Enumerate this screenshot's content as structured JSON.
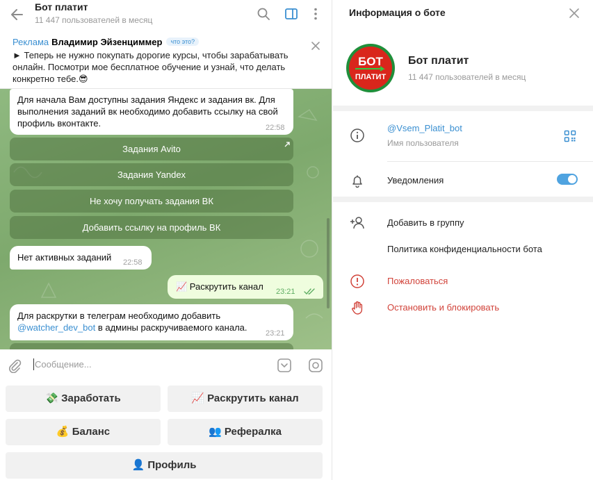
{
  "chat": {
    "title": "Бот платит",
    "subtitle": "11 447 пользователей в месяц"
  },
  "ad": {
    "label": "Реклама",
    "author": "Владимир Эйзенциммер",
    "what_is_it": "что это?",
    "text": "► Теперь не нужно покупать дорогие курсы, чтобы зарабатывать онлайн. Посмотри мое бесплатное обучение и узнай, что делать конкретно тебе.😎"
  },
  "messages": {
    "m1": {
      "text": "Для начала Вам доступны задания Яндекс и задания вк. Для выполнения заданий вк необходимо добавить ссылку на свой профиль вконтакте.",
      "time": "22:58"
    },
    "inline_buttons": [
      "Задания Avito",
      "Задания Yandex",
      "Не хочу получать задания ВК",
      "Добавить ссылку на профиль ВК"
    ],
    "m2": {
      "text": "Нет активных заданий",
      "time": "22:58"
    },
    "m3": {
      "text": "📈 Раскрутить канал",
      "time": "23:21"
    },
    "m4": {
      "text_before": "Для раскрутки в телеграм необходимо добавить",
      "link": "@watcher_dev_bot",
      "text_after": "в админы раскручиваемого канала.",
      "time": "23:21"
    }
  },
  "input": {
    "placeholder": "Сообщение..."
  },
  "reply_keyboard": {
    "earn": "💸 Заработать",
    "promote": "📈 Раскрутить канал",
    "balance": "💰 Баланс",
    "referral": "👥 Рефералка",
    "profile": "👤 Профиль"
  },
  "info": {
    "title": "Информация о боте",
    "bot_name": "Бот платит",
    "bot_sub": "11 447 пользователей в месяц",
    "avatar_logo_text": [
      "БОТ",
      "ПЛАТИТ"
    ],
    "username": "@Vsem_Platit_bot",
    "username_label": "Имя пользователя",
    "notifications": "Уведомления",
    "notifications_on": true,
    "add_to_group": "Добавить в группу",
    "privacy": "Политика конфиденциальности бота",
    "report": "Пожаловаться",
    "block": "Остановить и блокировать"
  },
  "colors": {
    "accent": "#3a8fd1",
    "danger": "#d1433a",
    "chat_bg": "#8fb980",
    "outgoing_bubble": "#effdde",
    "inline_button": "rgba(70,105,55,0.45)"
  }
}
